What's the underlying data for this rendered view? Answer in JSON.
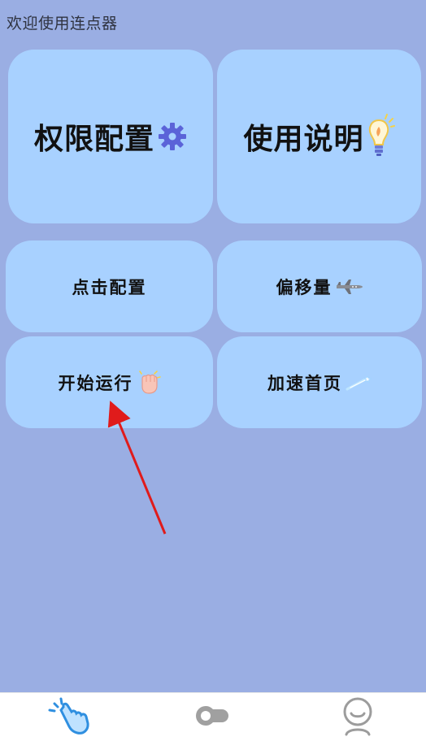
{
  "header": {
    "title": "欢迎使用连点器"
  },
  "cards": {
    "permission": {
      "label": "权限配置",
      "icon": "gear-icon"
    },
    "guide": {
      "label": "使用说明",
      "icon": "lightbulb-icon"
    },
    "click_config": {
      "label": "点击配置"
    },
    "offset": {
      "label": "偏移量",
      "icon": "airplane-icon"
    },
    "start": {
      "label": "开始运行",
      "icon": "fist-icon"
    },
    "speed_home": {
      "label": "加速首页",
      "icon": "shooting-star-icon"
    }
  },
  "bottom_nav": {
    "items": [
      {
        "name": "click",
        "icon": "tap-hand-icon",
        "active": true
      },
      {
        "name": "toggle",
        "icon": "toggle-icon",
        "active": false
      },
      {
        "name": "user",
        "icon": "user-icon",
        "active": false
      }
    ]
  },
  "colors": {
    "background": "#9aaee3",
    "card": "#a8d1ff",
    "accent": "#2f8fe0",
    "annotation_arrow": "#e01b1b"
  }
}
